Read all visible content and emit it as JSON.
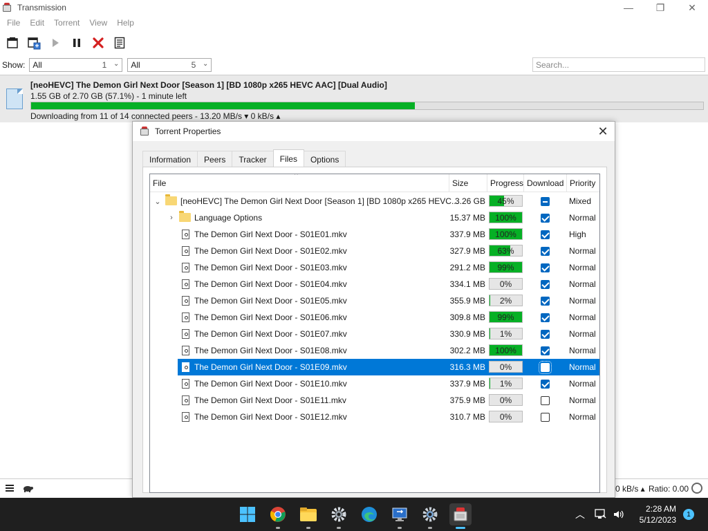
{
  "window": {
    "title": "Transmission",
    "controls": {
      "minimize": "—",
      "maximize": "❐",
      "close": "✕"
    }
  },
  "menu": [
    "File",
    "Edit",
    "Torrent",
    "View",
    "Help"
  ],
  "toolbar": {
    "icons": [
      "open-torrent-icon",
      "open-url-icon",
      "start-icon",
      "pause-icon",
      "remove-icon",
      "properties-icon"
    ]
  },
  "filter": {
    "show_label": "Show:",
    "status_value": "All",
    "status_count": "1",
    "tracker_value": "All",
    "tracker_count": "5",
    "search_placeholder": "Search..."
  },
  "torrent": {
    "name": "[neoHEVC] The Demon Girl Next Door [Season 1] [BD 1080p x265 HEVC AAC] [Dual Audio]",
    "size_info": "1.55 GB of 2.70 GB (57.1%) - 1 minute left",
    "progress": 0.571,
    "status": "Downloading from 11 of 14 connected peers - 13.20 MB/s ▾   0 kB/s ▴"
  },
  "statusbar": {
    "upload": "0 kB/s ▴",
    "ratio": "Ratio: 0.00"
  },
  "dialog": {
    "title": "Torrent Properties",
    "close": "✕",
    "tabs": [
      "Information",
      "Peers",
      "Tracker",
      "Files",
      "Options"
    ],
    "active_tab": "Files",
    "columns": {
      "file": "File",
      "size": "Size",
      "progress": "Progress",
      "download": "Download",
      "priority": "Priority"
    },
    "rows": [
      {
        "level": 0,
        "type": "folder",
        "expander": "⌄",
        "name": "[neoHEVC] The Demon Girl Next Door [Season 1] [BD 1080p x265 HEVC...",
        "size": "3.26 GB",
        "progress_text": "45%",
        "progress": 0.45,
        "download": "mixed",
        "priority": "Mixed"
      },
      {
        "level": 1,
        "type": "folder",
        "expander": "›",
        "name": "Language Options",
        "size": "15.37 MB",
        "progress_text": "100%",
        "progress": 1.0,
        "download": "on",
        "priority": "Normal"
      },
      {
        "level": 1,
        "type": "file",
        "name": "The Demon Girl Next Door - S01E01.mkv",
        "size": "337.9 MB",
        "progress_text": "100%",
        "progress": 1.0,
        "download": "on",
        "priority": "High"
      },
      {
        "level": 1,
        "type": "file",
        "name": "The Demon Girl Next Door - S01E02.mkv",
        "size": "327.9 MB",
        "progress_text": "63%",
        "progress": 0.63,
        "download": "on",
        "priority": "Normal"
      },
      {
        "level": 1,
        "type": "file",
        "name": "The Demon Girl Next Door - S01E03.mkv",
        "size": "291.2 MB",
        "progress_text": "99%",
        "progress": 0.99,
        "download": "on",
        "priority": "Normal"
      },
      {
        "level": 1,
        "type": "file",
        "name": "The Demon Girl Next Door - S01E04.mkv",
        "size": "334.1 MB",
        "progress_text": "0%",
        "progress": 0.0,
        "download": "on",
        "priority": "Normal"
      },
      {
        "level": 1,
        "type": "file",
        "name": "The Demon Girl Next Door - S01E05.mkv",
        "size": "355.9 MB",
        "progress_text": "2%",
        "progress": 0.02,
        "download": "on",
        "priority": "Normal"
      },
      {
        "level": 1,
        "type": "file",
        "name": "The Demon Girl Next Door - S01E06.mkv",
        "size": "309.8 MB",
        "progress_text": "99%",
        "progress": 0.99,
        "download": "on",
        "priority": "Normal"
      },
      {
        "level": 1,
        "type": "file",
        "name": "The Demon Girl Next Door - S01E07.mkv",
        "size": "330.9 MB",
        "progress_text": "1%",
        "progress": 0.01,
        "download": "on",
        "priority": "Normal"
      },
      {
        "level": 1,
        "type": "file",
        "name": "The Demon Girl Next Door - S01E08.mkv",
        "size": "302.2 MB",
        "progress_text": "100%",
        "progress": 1.0,
        "download": "on",
        "priority": "Normal"
      },
      {
        "level": 1,
        "type": "file",
        "name": "The Demon Girl Next Door - S01E09.mkv",
        "size": "316.3 MB",
        "progress_text": "0%",
        "progress": 0.0,
        "download": "off",
        "priority": "Normal",
        "selected": true
      },
      {
        "level": 1,
        "type": "file",
        "name": "The Demon Girl Next Door - S01E10.mkv",
        "size": "337.9 MB",
        "progress_text": "1%",
        "progress": 0.01,
        "download": "on",
        "priority": "Normal"
      },
      {
        "level": 1,
        "type": "file",
        "name": "The Demon Girl Next Door - S01E11.mkv",
        "size": "375.9 MB",
        "progress_text": "0%",
        "progress": 0.0,
        "download": "off",
        "priority": "Normal"
      },
      {
        "level": 1,
        "type": "file",
        "name": "The Demon Girl Next Door - S01E12.mkv",
        "size": "310.7 MB",
        "progress_text": "0%",
        "progress": 0.0,
        "download": "off",
        "priority": "Normal"
      }
    ]
  },
  "taskbar": {
    "apps": [
      "start-icon",
      "chrome-icon",
      "file-explorer-icon",
      "settings-gear-icon",
      "edge-icon",
      "remote-desktop-icon",
      "settings-icon",
      "transmission-icon"
    ],
    "active_app": "transmission-icon",
    "time": "2:28 AM",
    "date": "5/12/2023",
    "notification_count": "1"
  },
  "colors": {
    "progress_green": "#06b025",
    "selection_blue": "#0078d7",
    "checkbox_blue": "#0067c0"
  }
}
